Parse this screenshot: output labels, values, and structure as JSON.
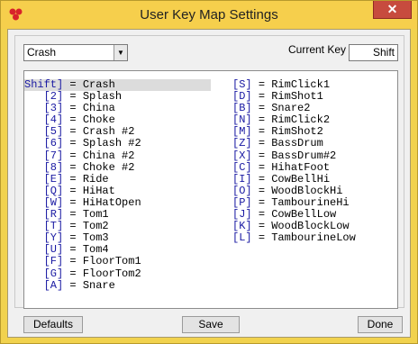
{
  "window": {
    "title": "User Key Map Settings",
    "close_glyph": "✕"
  },
  "kit_select": {
    "value": "Crash"
  },
  "current_key": {
    "label": "Current Key",
    "value": "Shift"
  },
  "left_column": [
    {
      "key": "Shift]",
      "name": "Crash"
    },
    {
      "key": "[2]",
      "name": "Splash"
    },
    {
      "key": "[3]",
      "name": "China"
    },
    {
      "key": "[4]",
      "name": "Choke"
    },
    {
      "key": "[5]",
      "name": "Crash #2"
    },
    {
      "key": "[6]",
      "name": "Splash #2"
    },
    {
      "key": "[7]",
      "name": "China #2"
    },
    {
      "key": "[8]",
      "name": "Choke #2"
    },
    {
      "key": "[E]",
      "name": "Ride"
    },
    {
      "key": "[Q]",
      "name": "HiHat"
    },
    {
      "key": "[W]",
      "name": "HiHatOpen"
    },
    {
      "key": "[R]",
      "name": "Tom1"
    },
    {
      "key": "[T]",
      "name": "Tom2"
    },
    {
      "key": "[Y]",
      "name": "Tom3"
    },
    {
      "key": "[U]",
      "name": "Tom4"
    },
    {
      "key": "[F]",
      "name": "FloorTom1"
    },
    {
      "key": "[G]",
      "name": "FloorTom2"
    },
    {
      "key": "[A]",
      "name": "Snare"
    }
  ],
  "right_column": [
    {
      "key": "[S]",
      "name": "RimClick1"
    },
    {
      "key": "[D]",
      "name": "RimShot1"
    },
    {
      "key": "[B]",
      "name": "Snare2"
    },
    {
      "key": "[N]",
      "name": "RimClick2"
    },
    {
      "key": "[M]",
      "name": "RimShot2"
    },
    {
      "key": "[Z]",
      "name": "BassDrum"
    },
    {
      "key": "[X]",
      "name": "BassDrum#2"
    },
    {
      "key": "[C]",
      "name": "HihatFoot"
    },
    {
      "key": "[I]",
      "name": "CowBellHi"
    },
    {
      "key": "[O]",
      "name": "WoodBlockHi"
    },
    {
      "key": "[P]",
      "name": "TambourineHi"
    },
    {
      "key": "[J]",
      "name": "CowBellLow"
    },
    {
      "key": "[K]",
      "name": "WoodBlockLow"
    },
    {
      "key": "[L]",
      "name": "TambourineLow"
    }
  ],
  "equals": "=",
  "buttons": {
    "defaults": "Defaults",
    "save": "Save",
    "done": "Done"
  },
  "colors": {
    "key_text": "#1a1aa3",
    "titlebar": "#f6cf4c",
    "close": "#c74b3e"
  },
  "icons": {
    "app": "red-dots-icon",
    "dropdown": "chevron-down-icon",
    "close": "close-icon"
  }
}
